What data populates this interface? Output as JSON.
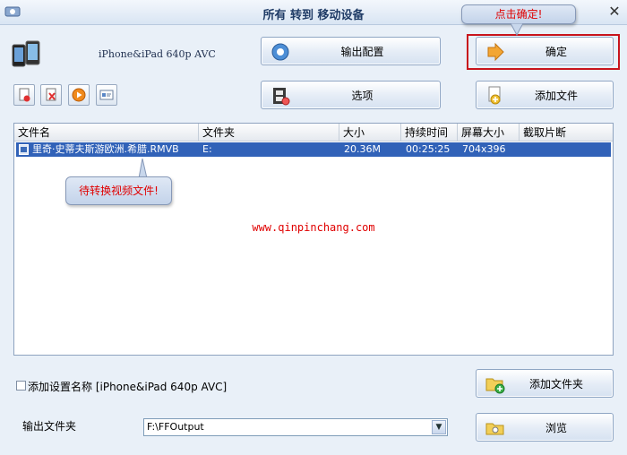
{
  "window": {
    "title": "所有 转到 移动设备",
    "close_label": "✕"
  },
  "device": {
    "name": "iPhone&iPad 640p AVC"
  },
  "buttons": {
    "output_config": "输出配置",
    "confirm": "确定",
    "options": "选项",
    "add_file": "添加文件",
    "add_folder": "添加文件夹",
    "browse": "浏览"
  },
  "toolbar": {
    "icons": [
      "remove-file-icon",
      "clear-list-icon",
      "play-icon",
      "info-icon"
    ]
  },
  "file_list": {
    "columns": [
      "文件名",
      "文件夹",
      "大小",
      "持续时间",
      "屏幕大小",
      "截取片断"
    ],
    "rows": [
      {
        "name": "里奇·史蒂夫斯游欧洲.希腊.RMVB",
        "folder": "E:",
        "size": "20.36M",
        "duration": "00:25:25",
        "screen": "704x396",
        "clip": ""
      }
    ]
  },
  "callouts": {
    "confirm_tip": "点击确定!",
    "file_tip": "待转换视频文件!"
  },
  "watermark": "www.qinpinchang.com",
  "settings": {
    "add_name_label": "添加设置名称 [iPhone&iPad 640p AVC]",
    "add_name_checked": false
  },
  "output": {
    "label": "输出文件夹",
    "folder": "F:\\FFOutput"
  },
  "colors": {
    "selection": "#3162b8",
    "highlight_frame": "#c8141c",
    "callout_text": "#e00000"
  }
}
